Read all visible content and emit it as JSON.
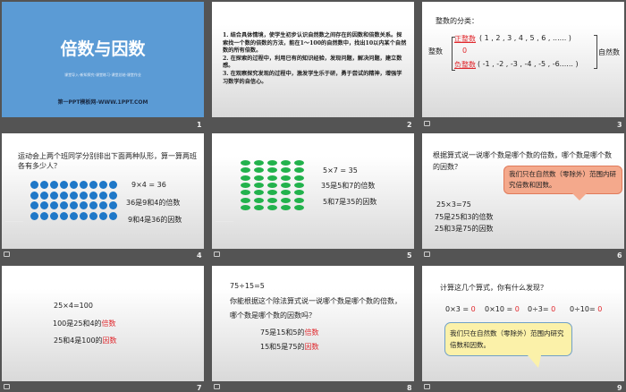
{
  "slides": [
    {
      "number": "1",
      "title": "倍数与因数",
      "subtitle": "课堂导入-新知探究-课堂练习-课堂总结-课堂作业",
      "footer": "第一PPT模板网-WWW.1PPT.COM",
      "bg": "#5b9bd5"
    },
    {
      "number": "2",
      "lines": [
        "1. 结合具体情境，使学生初步认识自然数之间存在的因数和倍数关系。探索找一个数的倍数的方法，能在1～100的自然数中，找出10以内某个自然数的所有倍数。",
        "2. 在探索的过程中，利用已有的知识经验，发现问题，解决问题，建立数感。",
        "3. 在观察探究发现的过程中，激发学生乐于研，勇于尝试的精神，增强学习数学的自信心。"
      ]
    },
    {
      "number": "3",
      "heading": "整数的分类：",
      "left": "整数",
      "positive": "正整数",
      "positive_values": "( 1 , 2 , 3 , 4 , 5 , 6 , ...... )",
      "zero": "0",
      "negative": "负整数",
      "negative_values": "( -1 , -2 , -3 , -4 , -5 , -6...... )",
      "right": "自然数"
    },
    {
      "number": "4",
      "question": "运动会上两个班同学分别排出下面两种队形，算一算两班各有多少人？",
      "eq": "9×4 = 36",
      "l1": "36是9和4的倍数",
      "l2": "9和4是36的因数",
      "dot_cols": 9,
      "dot_rows": 4,
      "dot_color": "#1f78c8"
    },
    {
      "number": "5",
      "eq": "5×7 = 35",
      "l1": "35是5和7的倍数",
      "l2": "5和7是35的因数",
      "dot_cols": 5,
      "dot_rows": 7,
      "dot_color": "#22b24c"
    },
    {
      "number": "6",
      "question": "根据算式说一说哪个数是哪个数的倍数，哪个数是哪个数的因数？",
      "callout": "我们只在自然数（零除外）范围内研究倍数和因数。",
      "eq": "25×3=75",
      "l1": "75是25和3的倍数",
      "l2": "25和3是75的因数"
    },
    {
      "number": "7",
      "eq": "25×4=100",
      "l1a": "100是25和4的",
      "l1b": "倍数",
      "l2a": "25和4是100的",
      "l2b": "因数"
    },
    {
      "number": "8",
      "eq": "75÷15=5",
      "question": "你能根据这个除法算式说一说哪个数是哪个数的倍数，哪个数是哪个数的因数吗？",
      "l1a": "75是15和5的",
      "l1b": "倍数",
      "l2a": "15和5是75的",
      "l2b": "因数"
    },
    {
      "number": "9",
      "question": "计算这几个算式，你有什么发现？",
      "eqs": [
        {
          "a": "0×3 = ",
          "b": "0"
        },
        {
          "a": "0×10 = ",
          "b": "0"
        },
        {
          "a": "0÷3= ",
          "b": "0"
        },
        {
          "a": "0÷10= ",
          "b": "0"
        }
      ],
      "callout": "我们只在自然数（零除外）范围内研究倍数和因数。"
    }
  ]
}
